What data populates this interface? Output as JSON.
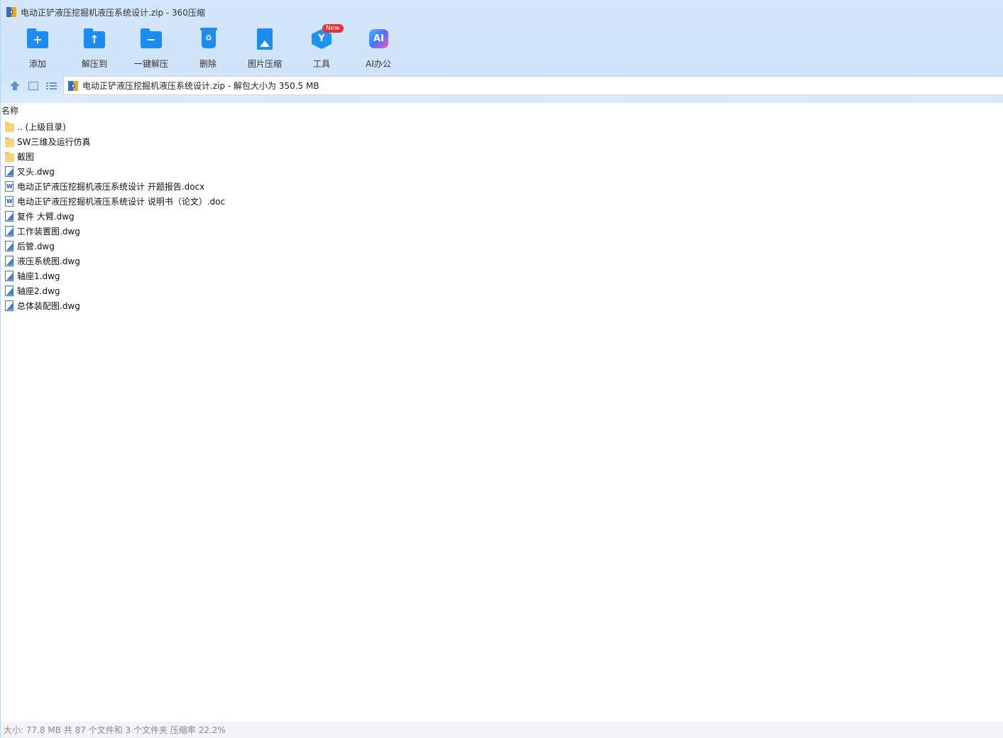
{
  "window": {
    "title": "电动正铲液压挖掘机液压系统设计.zip - 360压缩"
  },
  "toolbar": {
    "items": [
      {
        "label": "添加",
        "icon": "add-folder-icon"
      },
      {
        "label": "解压到",
        "icon": "extract-to-icon"
      },
      {
        "label": "一键解压",
        "icon": "one-click-extract-icon"
      },
      {
        "label": "删除",
        "icon": "delete-icon"
      },
      {
        "label": "图片压缩",
        "icon": "image-compress-icon"
      },
      {
        "label": "工具",
        "icon": "tools-icon",
        "badge": "New"
      },
      {
        "label": "AI办公",
        "icon": "ai-office-icon"
      }
    ]
  },
  "nav": {
    "path_text": "电动正铲液压挖掘机液压系统设计.zip - 解包大小为 350.5 MB"
  },
  "list": {
    "column_name": "名称",
    "items": [
      {
        "name": ".. (上级目录)",
        "type": "folder"
      },
      {
        "name": "SW三维及运行仿真",
        "type": "folder"
      },
      {
        "name": "截图",
        "type": "folder"
      },
      {
        "name": "叉头.dwg",
        "type": "dwg"
      },
      {
        "name": "电动正铲液压挖掘机液压系统设计 开题报告.docx",
        "type": "doc"
      },
      {
        "name": "电动正铲液压挖掘机液压系统设计 说明书（论文）.doc",
        "type": "doc"
      },
      {
        "name": "复件 大臂.dwg",
        "type": "dwg"
      },
      {
        "name": "工作装置图.dwg",
        "type": "dwg"
      },
      {
        "name": "后管.dwg",
        "type": "dwg"
      },
      {
        "name": "液压系统图.dwg",
        "type": "dwg"
      },
      {
        "name": "轴座1.dwg",
        "type": "dwg"
      },
      {
        "name": "轴座2.dwg",
        "type": "dwg"
      },
      {
        "name": "总体装配图.dwg",
        "type": "dwg"
      }
    ]
  },
  "status": {
    "text": "大小: 77.8 MB 共 87 个文件和 3 个文件夹 压缩率 22.2%"
  },
  "colors": {
    "accent": "#1b8cf0",
    "header_bg": "#d3e6fb",
    "badge": "#ee2d3c"
  }
}
